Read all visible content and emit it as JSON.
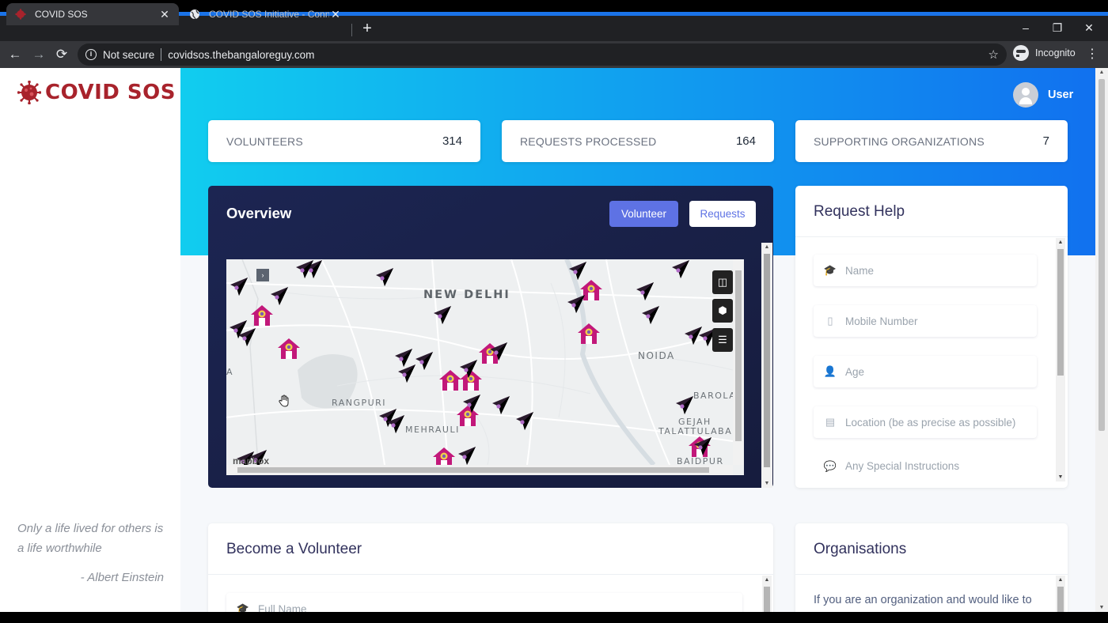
{
  "browser": {
    "tabs": [
      {
        "title": "COVID SOS",
        "active": true
      },
      {
        "title": "COVID SOS Initiative - Connecting",
        "active": false
      }
    ],
    "new_tab": "+",
    "security_label": "Not secure",
    "url": "covidsos.thebangaloreguy.com",
    "profile_label": "Incognito",
    "window_controls": {
      "minimize": "–",
      "restore": "❐",
      "close": "✕"
    }
  },
  "sidebar": {
    "logo_text": "COVID SOS",
    "quote": "Only a life lived for others is a life worthwhile",
    "quote_author": "- Albert Einstein"
  },
  "header": {
    "user_label": "User"
  },
  "stats": [
    {
      "label": "VOLUNTEERS",
      "value": "314"
    },
    {
      "label": "REQUESTS PROCESSED",
      "value": "164"
    },
    {
      "label": "SUPPORTING ORGANIZATIONS",
      "value": "7"
    }
  ],
  "overview": {
    "title": "Overview",
    "buttons": {
      "volunteer": "Volunteer",
      "requests": "Requests"
    },
    "map": {
      "labels": {
        "new_delhi": "NEW DELHI",
        "noida": "NOIDA",
        "rangpuri": "RANGPURI",
        "mehrauli": "MEHRAULI",
        "barola": "BAROLA",
        "gejah": "GEJAH",
        "talattulabad": "TALATTULABAD",
        "baidpur": "BAIDPUR",
        "edge_a": "A"
      },
      "attribution": "mapbox"
    }
  },
  "request_help": {
    "title": "Request Help",
    "fields": [
      {
        "icon": "graduation-cap-icon",
        "placeholder": "Name"
      },
      {
        "icon": "mobile-icon",
        "placeholder": "Mobile Number"
      },
      {
        "icon": "user-clock-icon",
        "placeholder": "Age"
      },
      {
        "icon": "id-card-icon",
        "placeholder": "Location (be as precise as possible)"
      },
      {
        "icon": "comments-icon",
        "placeholder": "Any Special Instructions"
      }
    ]
  },
  "volunteer_card": {
    "title": "Become a Volunteer",
    "first_field_placeholder": "Full Name"
  },
  "organisations": {
    "title": "Organisations",
    "text": "If you are an organization and would like to"
  },
  "colors": {
    "brand_red": "#a8232c",
    "accent_indigo": "#5e72e4",
    "hero_start": "#11cdef",
    "hero_end": "#1171ef",
    "home_marker": "#c2187a",
    "volunteer_marker": "#2b1b2e"
  }
}
